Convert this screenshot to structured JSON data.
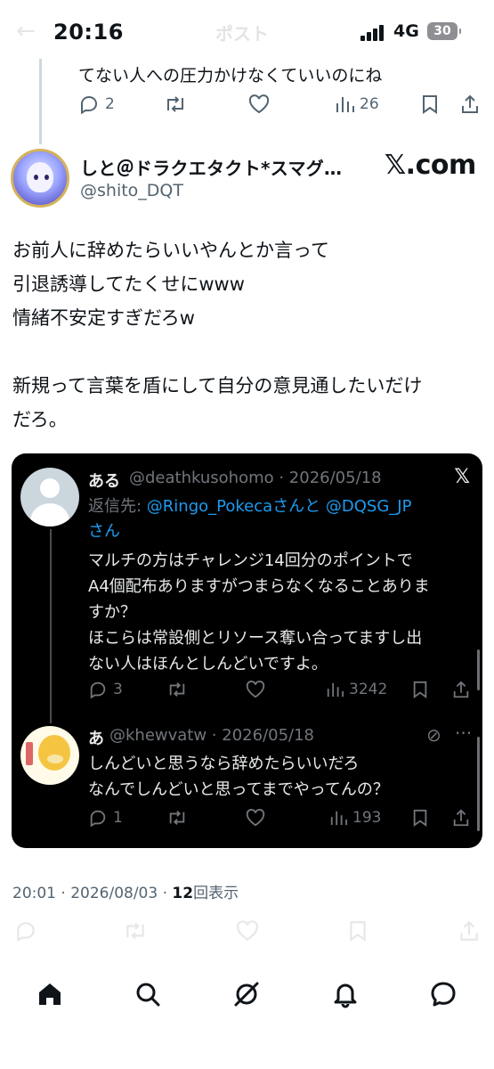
{
  "status_bar": {
    "time": "20:16",
    "network": "4G",
    "battery": "30",
    "faded_title": "ポスト"
  },
  "previous_post": {
    "text": "てない人への圧力かけなくていいのにね",
    "reply_count": "2",
    "view_count": "26"
  },
  "author": {
    "display_name": "しと＠ドラクエタクト*スマグ…",
    "handle": "@shito_DQT",
    "watermark": "𝕏.com"
  },
  "post": {
    "body": "お前人に辞めたらいいやんとか言って\n引退誘導してたくせにwww\n情緒不安定すぎだろw\n\n新規って言葉を盾にして自分の意見通したいだけ\nだろ。"
  },
  "embed": {
    "tweet1": {
      "name": "ある",
      "meta": "@deathkusohomo · 2026/05/18",
      "reply_prefix": "返信先: ",
      "reply_mentions": "@Ringo_Pokecaさんと @DQSG_JP",
      "reply_suffix": "さん",
      "text": "マルチの方はチャレンジ14回分のポイントで\nA4個配布ありますがつまらなくなることありま\nすか？\nほこらは常設側とリソース奪い合ってますし出\nない人はほんとしんどいですよ。",
      "reply_count": "3",
      "view_count": "3242"
    },
    "tweet2": {
      "name": "あ",
      "meta": "@khewvatw · 2026/05/18",
      "text": "しんどいと思うなら辞めたらいいだろ\nなんでしんどいと思ってまでやってんの？",
      "reply_count": "1",
      "view_count": "193"
    }
  },
  "timestamp": {
    "time_date": "20:01 · 2026/08/03 · ",
    "views": "12",
    "views_label": "回表示"
  },
  "colors": {
    "text": "#0f1419",
    "muted": "#536471",
    "link": "#1d9bf0",
    "card_bg": "#000000"
  },
  "nav": [
    "home-icon",
    "search-icon",
    "grok-icon",
    "bell-icon",
    "messages-icon"
  ]
}
